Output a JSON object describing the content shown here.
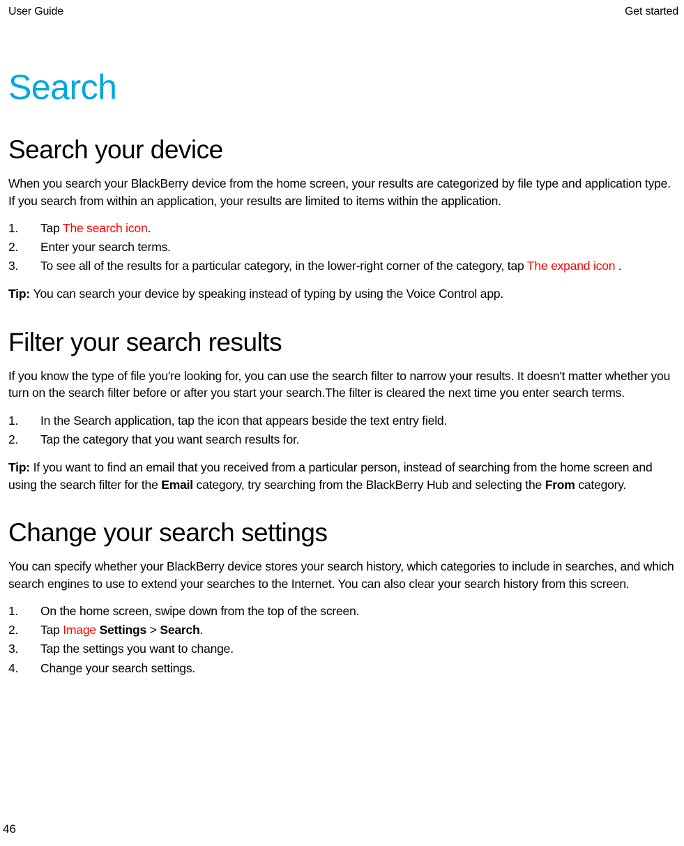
{
  "header": {
    "left": "User Guide",
    "right": "Get started"
  },
  "mainTitle": "Search",
  "sec1": {
    "title": "Search your device",
    "intro": "When you search your BlackBerry device from the home screen, your results are categorized by file type and application type. If you search from within an application, your results are limited to items within the application.",
    "li1_a": "Tap ",
    "li1_icon": "The search icon",
    "li1_b": ".",
    "li2": "Enter your search terms.",
    "li3_a": "To see all of the results for a particular category, in the lower-right corner of the category, tap ",
    "li3_icon": "The expand icon",
    "li3_b": " .",
    "tip_label": "Tip: ",
    "tip_text": "You can search your device by speaking instead of typing by using the Voice Control app."
  },
  "sec2": {
    "title": "Filter your search results",
    "intro": "If you know the type of file you're looking for, you can use the search filter to narrow your results. It doesn't matter whether you turn on the search filter before or after you start your search.The filter is cleared the next time you enter search terms.",
    "li1": "In the Search application, tap the icon that appears beside the text entry field.",
    "li2": "Tap the category that you want search results for.",
    "tip_label": "Tip: ",
    "tip_a": "If you want to find an email that you received from a particular person, instead of searching from the home screen and using the search filter for the ",
    "tip_bold1": "Email",
    "tip_b": " category, try searching from the BlackBerry Hub and selecting the ",
    "tip_bold2": "From",
    "tip_c": " category."
  },
  "sec3": {
    "title": "Change your search settings",
    "intro": "You can specify whether your BlackBerry device stores your search history, which categories to include in searches, and which search engines to use to extend your searches to the Internet. You can also clear your search history from this screen.",
    "li1": "On the home screen, swipe down from the top of the screen.",
    "li2_a": "Tap ",
    "li2_icon": "Image",
    "li2_b": " ",
    "li2_bold1": "Settings",
    "li2_c": " > ",
    "li2_bold2": "Search",
    "li2_d": ".",
    "li3": "Tap the settings you want to change.",
    "li4": "Change your search settings."
  },
  "pageNumber": "46"
}
